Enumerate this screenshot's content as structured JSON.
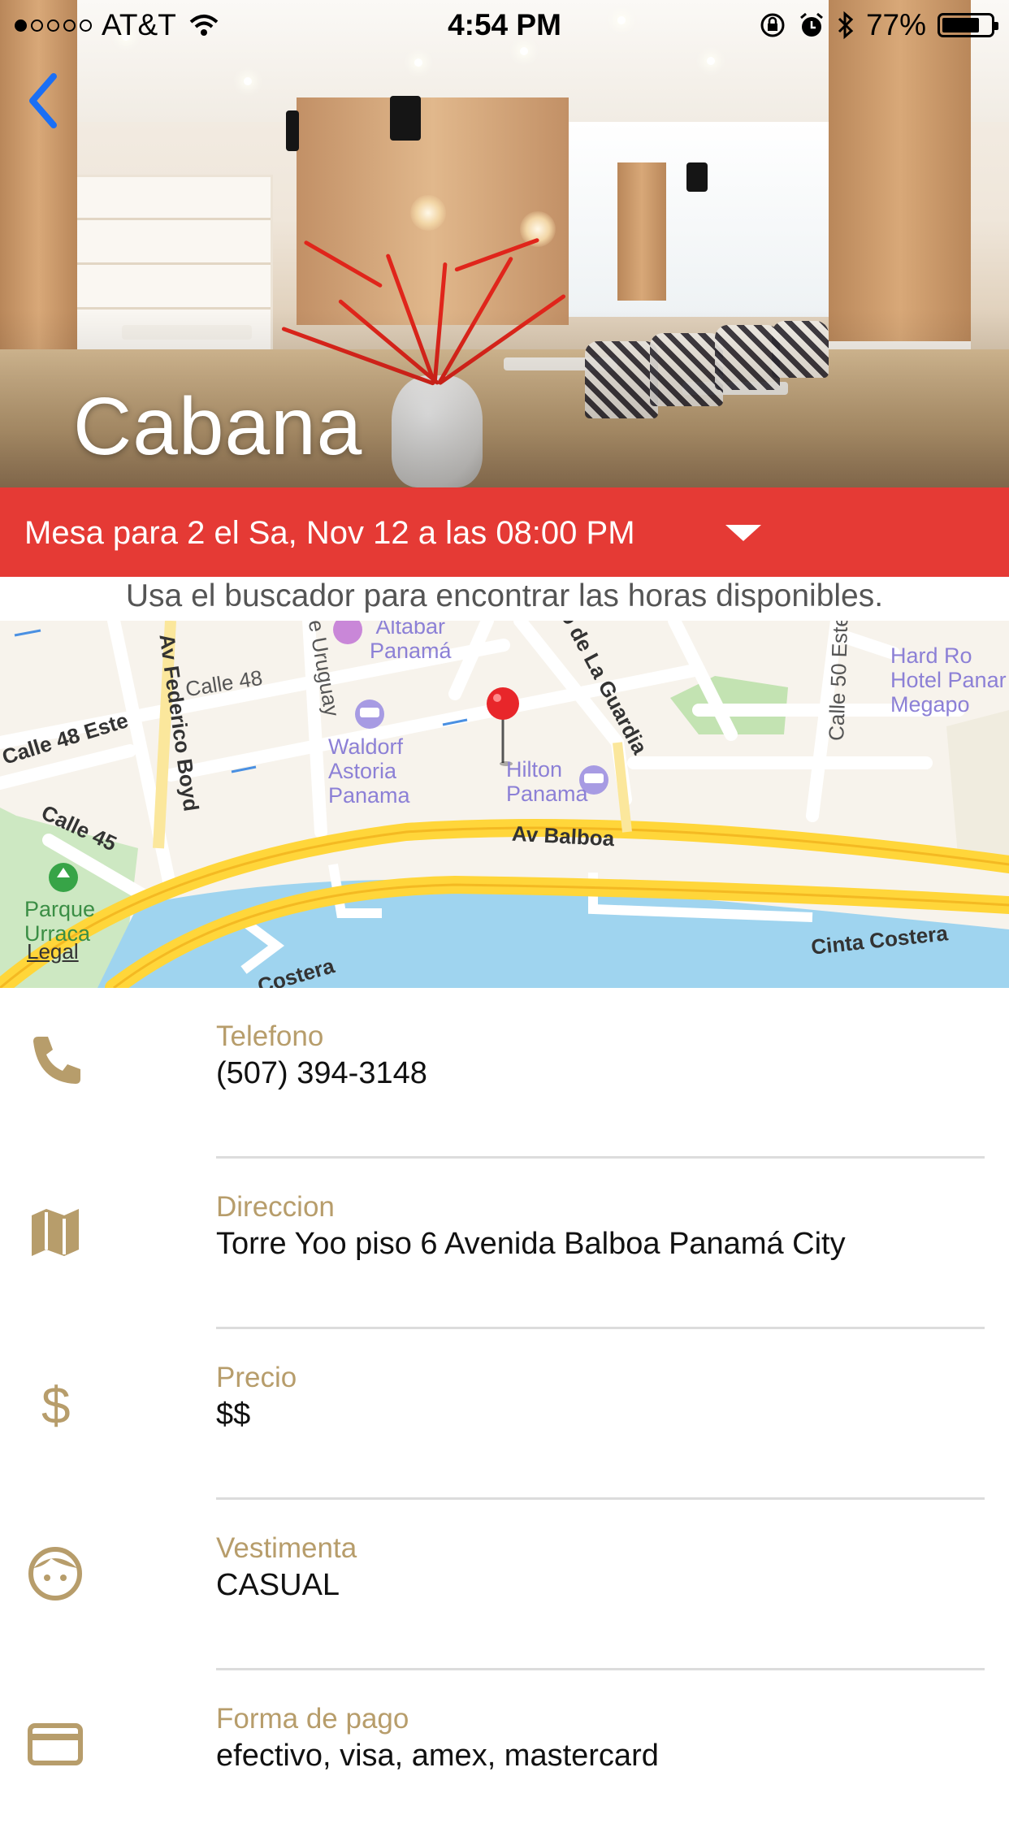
{
  "status_bar": {
    "carrier": "AT&T",
    "time": "4:54 PM",
    "battery_percent": "77%",
    "battery_level": 0.77,
    "signal_bars_filled": 1,
    "icons": [
      "wifi-icon",
      "rotation-lock-icon",
      "alarm-icon",
      "bluetooth-icon",
      "battery-icon"
    ]
  },
  "hero": {
    "restaurant_name": "Cabana",
    "back_icon": "chevron-left-icon"
  },
  "reservation": {
    "summary": "Mesa para 2 el Sa, Nov 12 a las 08:00 PM",
    "hint": "Usa el buscador para encontrar las horas disponibles."
  },
  "map": {
    "streets": [
      "Calle 48",
      "Calle 48 Este",
      "Calle 45",
      "Av Federico Boyd",
      "Av Balboa",
      "Cinta Costera",
      "Costera",
      "Calle 50 Este",
      "le Uruguay",
      "o de La Guardia"
    ],
    "pois": {
      "altabar": "Altabar\nPanamá",
      "waldorf": "Waldorf\nAstoria\nPanama",
      "hilton": "Hilton\nPanama",
      "hardrock": "Hard Ro\nHotel Panar\nMegapo"
    },
    "park": "Parque\nUrraca",
    "legal": "Legal"
  },
  "details": [
    {
      "icon": "phone-icon",
      "label": "Telefono",
      "value": "(507) 394-3148"
    },
    {
      "icon": "map-icon",
      "label": "Direccion",
      "value": "Torre Yoo piso 6 Avenida Balboa Panamá City"
    },
    {
      "icon": "dollar-icon",
      "label": "Precio",
      "value": "$$"
    },
    {
      "icon": "face-icon",
      "label": "Vestimenta",
      "value": "CASUAL"
    },
    {
      "icon": "credit-card-icon",
      "label": "Forma de pago",
      "value": "efectivo, visa, amex, mastercard"
    }
  ],
  "colors": {
    "accent_red": "#e53a35",
    "label_gold": "#b79d6b",
    "back_blue": "#1a6ff5"
  }
}
